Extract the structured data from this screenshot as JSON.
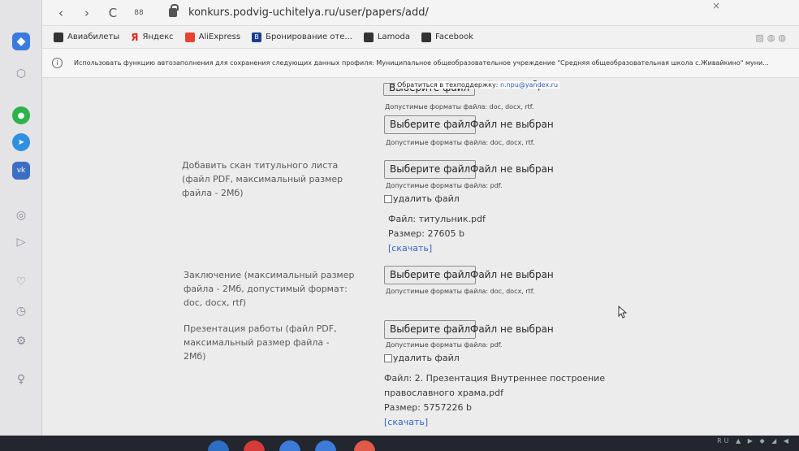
{
  "browser": {
    "url": "konkurs.podvig-uchitelya.ru/user/papers/add/",
    "tab_close": "×",
    "nav": {
      "back": "‹",
      "forward": "›",
      "reload": "C",
      "grid": "88"
    },
    "bookmarks": [
      {
        "label": "Авиабилеты",
        "color": "#333333"
      },
      {
        "label": "Яндекс",
        "color": "#e3261d"
      },
      {
        "label": "AliExpress",
        "color": "#e8432f"
      },
      {
        "label": "Бронирование оте...",
        "color": "#1b3f8a"
      },
      {
        "label": "Lamoda",
        "color": "#333333"
      },
      {
        "label": "Facebook",
        "color": "#333333"
      }
    ],
    "bookmark_prefix_ya": "Я",
    "bookmark_prefix_b": "B",
    "infobar": {
      "icon": "i",
      "text": "Использовать функцию автозаполнения для сохранения следующих данных профиля: Муниципальное общеобразовательное учреждение \"Средняя общеобразовательная школа с.Живайкино\" муни..."
    },
    "support": {
      "text": "Обратиться в техподдержку:",
      "email": "n.npu@yandex.ru"
    }
  },
  "form": {
    "choose_label": "Выберите файл",
    "no_file": "Файл не выбран",
    "delete_label": "удалить файл",
    "download_label": "[скачать]",
    "formats_doc": "Допустимые форматы файла: doc, docx, rtf.",
    "formats_pdf": "Допустимые форматы файла: pdf.",
    "title_scan": {
      "label": "Добавить скан титульного листа (файл PDF, максимальный размер файла - 2Мб)",
      "file": "Файл: титульник.pdf",
      "size": "Размер: 27605 b"
    },
    "conclusion": {
      "label": "Заключение (максимальный размер файла - 2Мб, допустимый формат: doc, docx, rtf)"
    },
    "presentation": {
      "label": "Презентация работы (файл PDF, максимальный размер файла - 2Мб)",
      "file_line1": "Файл: 2. Презентация Внутреннее построение",
      "file_line2": "православного храма.pdf",
      "size": "Размер: 5757226 b"
    }
  },
  "taskbar": {
    "tray": "RU ▲ ▶ ◆ ◢ ◀"
  },
  "colors": {
    "accent": "#2a55b8",
    "link": "#3564c8"
  }
}
